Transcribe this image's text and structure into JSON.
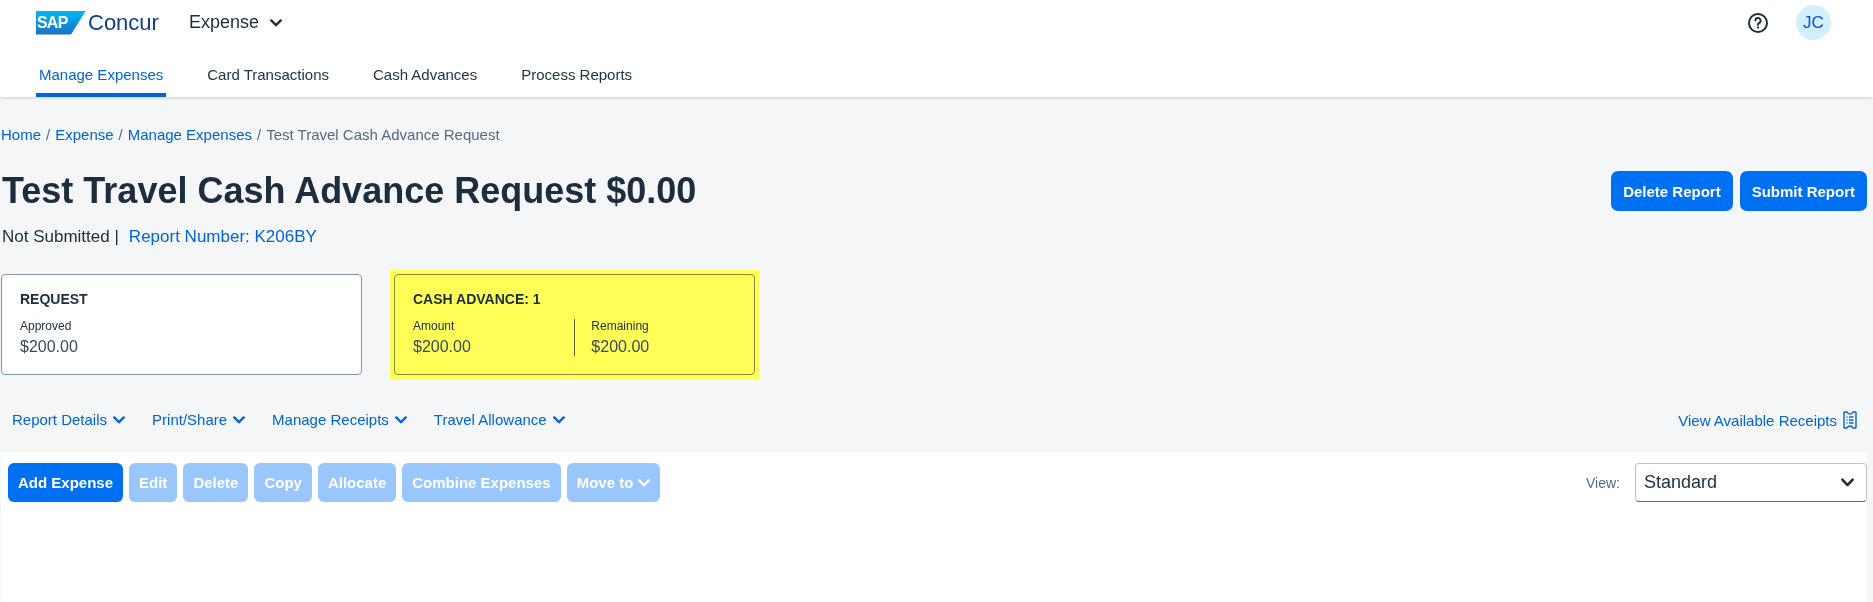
{
  "header": {
    "logo": {
      "mark": "SAP",
      "name": "Concur"
    },
    "product_menu": "Expense",
    "avatar_initials": "JC"
  },
  "tabs": [
    {
      "label": "Manage Expenses",
      "selected": true
    },
    {
      "label": "Card Transactions",
      "selected": false
    },
    {
      "label": "Cash Advances",
      "selected": false
    },
    {
      "label": "Process Reports",
      "selected": false
    }
  ],
  "breadcrumb": [
    {
      "kind": "link",
      "label": "Home"
    },
    {
      "kind": "separator",
      "label": "/"
    },
    {
      "kind": "link",
      "label": "Expense"
    },
    {
      "kind": "separator",
      "label": "/"
    },
    {
      "kind": "link",
      "label": "Manage Expenses"
    },
    {
      "kind": "separator",
      "label": "/"
    },
    {
      "kind": "current",
      "label": "Test Travel Cash Advance Request"
    }
  ],
  "report": {
    "title": "Test Travel Cash Advance Request $0.00",
    "status": "Not Submitted |",
    "number_link": "Report Number: K206BY",
    "actions": [
      "Delete Report",
      "Submit Report"
    ]
  },
  "summary_cards": [
    {
      "title": "REQUEST",
      "highlighted": false,
      "fields": [
        {
          "label": "Approved",
          "value": "$200.00"
        }
      ]
    },
    {
      "title": "CASH ADVANCE: 1",
      "highlighted": true,
      "fields": [
        {
          "label": "Amount",
          "value": "$200.00"
        },
        {
          "label": "Remaining",
          "value": "$200.00"
        }
      ]
    }
  ],
  "action_menus": [
    "Report Details",
    "Print/Share",
    "Manage Receipts",
    "Travel Allowance"
  ],
  "receipts_link": "View Available Receipts",
  "expense_toolbar": {
    "buttons": [
      {
        "label": "Add Expense",
        "disabled": false,
        "kind": "button"
      },
      {
        "label": "Edit",
        "disabled": true,
        "kind": "button"
      },
      {
        "label": "Delete",
        "disabled": true,
        "kind": "button"
      },
      {
        "label": "Copy",
        "disabled": true,
        "kind": "button"
      },
      {
        "label": "Allocate",
        "disabled": true,
        "kind": "button"
      },
      {
        "label": "Combine Expenses",
        "disabled": true,
        "kind": "button"
      },
      {
        "label": "Move to",
        "disabled": true,
        "kind": "dropdown"
      }
    ],
    "view": {
      "label": "View:",
      "value": "Standard"
    }
  }
}
